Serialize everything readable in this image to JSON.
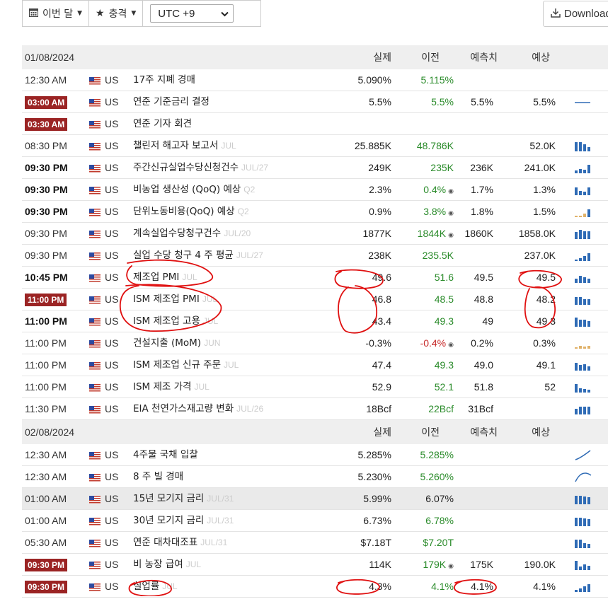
{
  "toolbar": {
    "period_label": "이번 달",
    "impact_label": "충격",
    "timezone_value": "UTC +9",
    "download_label": "Download"
  },
  "headers": {
    "actual": "실제",
    "previous": "이전",
    "forecast": "예측치",
    "consensus": "예상"
  },
  "sections": [
    {
      "date": "01/08/2024",
      "rows": [
        {
          "time": "12:30 AM",
          "style": "normal",
          "country": "US",
          "event": "17주 지폐 경매",
          "period": "",
          "actual": "5.090%",
          "previous": "5.115%",
          "prev_style": "green",
          "prev_dot": "",
          "forecast": "",
          "consensus": "",
          "chart": "none"
        },
        {
          "time": "03:00 AM",
          "style": "badge",
          "country": "US",
          "event": "연준 기준금리 결정",
          "period": "",
          "actual": "5.5%",
          "previous": "5.5%",
          "prev_style": "green",
          "prev_dot": "",
          "forecast": "5.5%",
          "consensus": "5.5%",
          "chart": "line"
        },
        {
          "time": "03:30 AM",
          "style": "badge",
          "country": "US",
          "event": "연준 기자 회견",
          "period": "",
          "actual": "",
          "previous": "",
          "prev_style": "green",
          "prev_dot": "",
          "forecast": "",
          "consensus": "",
          "chart": "none"
        },
        {
          "time": "08:30 PM",
          "style": "normal",
          "country": "US",
          "event": "챌린저 해고자 보고서",
          "period": "JUL",
          "actual": "25.885K",
          "previous": "48.786K",
          "prev_style": "green",
          "prev_dot": "",
          "forecast": "",
          "consensus": "52.0K",
          "chart": "bars-a"
        },
        {
          "time": "09:30 PM",
          "style": "bold",
          "country": "US",
          "event": "주간신규실업수당신청건수",
          "period": "JUL/27",
          "actual": "249K",
          "previous": "235K",
          "prev_style": "green",
          "prev_dot": "",
          "forecast": "236K",
          "consensus": "241.0K",
          "chart": "bars-b"
        },
        {
          "time": "09:30 PM",
          "style": "bold",
          "country": "US",
          "event": "비농업 생산성 (QoQ) 예상",
          "period": "Q2",
          "actual": "2.3%",
          "previous": "0.4%",
          "prev_style": "green",
          "prev_dot": "◉",
          "forecast": "1.7%",
          "consensus": "1.3%",
          "chart": "bars-c"
        },
        {
          "time": "09:30 PM",
          "style": "bold",
          "country": "US",
          "event": "단위노동비용(QoQ) 예상",
          "period": "Q2",
          "actual": "0.9%",
          "previous": "3.8%",
          "prev_style": "green",
          "prev_dot": "◉",
          "forecast": "1.8%",
          "consensus": "1.5%",
          "chart": "bars-mixed"
        },
        {
          "time": "09:30 PM",
          "style": "normal",
          "country": "US",
          "event": "계속실업수당청구건수",
          "period": "JUL/20",
          "actual": "1877K",
          "previous": "1844K",
          "prev_style": "green",
          "prev_dot": "◉",
          "forecast": "1860K",
          "consensus": "1858.0K",
          "chart": "bars-d"
        },
        {
          "time": "09:30 PM",
          "style": "normal",
          "country": "US",
          "event": "실업 수당 청구 4 주 평균",
          "period": "JUL/27",
          "actual": "238K",
          "previous": "235.5K",
          "prev_style": "green",
          "prev_dot": "",
          "forecast": "",
          "consensus": "237.0K",
          "chart": "bars-e"
        },
        {
          "time": "10:45 PM",
          "style": "bold",
          "country": "US",
          "event": "제조업 PMI",
          "period": "JUL",
          "actual": "49.6",
          "previous": "51.6",
          "prev_style": "green",
          "prev_dot": "",
          "forecast": "49.5",
          "consensus": "49.5",
          "chart": "bars-f"
        },
        {
          "time": "11:00 PM",
          "style": "badge",
          "country": "US",
          "event": "ISM 제조업 PMI",
          "period": "JUL",
          "actual": "46.8",
          "previous": "48.5",
          "prev_style": "green",
          "prev_dot": "",
          "forecast": "48.8",
          "consensus": "48.2",
          "chart": "bars-g"
        },
        {
          "time": "11:00 PM",
          "style": "bold",
          "country": "US",
          "event": "ISM 제조업 고용",
          "period": "JUL",
          "actual": "43.4",
          "previous": "49.3",
          "prev_style": "green",
          "prev_dot": "",
          "forecast": "49",
          "consensus": "49.3",
          "chart": "bars-h"
        },
        {
          "time": "11:00 PM",
          "style": "normal",
          "country": "US",
          "event": "건설지출 (MoM)",
          "period": "JUN",
          "actual": "-0.3%",
          "previous": "-0.4%",
          "prev_style": "red",
          "prev_dot": "◉",
          "forecast": "0.2%",
          "consensus": "0.3%",
          "chart": "bars-mixed2"
        },
        {
          "time": "11:00 PM",
          "style": "normal",
          "country": "US",
          "event": "ISM 제조업 신규 주문",
          "period": "JUL",
          "actual": "47.4",
          "previous": "49.3",
          "prev_style": "green",
          "prev_dot": "",
          "forecast": "49.0",
          "consensus": "49.1",
          "chart": "bars-i"
        },
        {
          "time": "11:00 PM",
          "style": "normal",
          "country": "US",
          "event": "ISM 제조 가격",
          "period": "JUL",
          "actual": "52.9",
          "previous": "52.1",
          "prev_style": "green",
          "prev_dot": "",
          "forecast": "51.8",
          "consensus": "52",
          "chart": "bars-j"
        },
        {
          "time": "11:30 PM",
          "style": "normal",
          "country": "US",
          "event": "EIA 천연가스재고량 변화",
          "period": "JUL/26",
          "actual": "18Bcf",
          "previous": "22Bcf",
          "prev_style": "green",
          "prev_dot": "",
          "forecast": "31Bcf",
          "consensus": "",
          "chart": "bars-k"
        }
      ]
    },
    {
      "date": "02/08/2024",
      "rows": [
        {
          "time": "12:30 AM",
          "style": "normal",
          "country": "US",
          "event": "4주물 국채 입찰",
          "period": "",
          "actual": "5.285%",
          "previous": "5.285%",
          "prev_style": "green",
          "prev_dot": "",
          "forecast": "",
          "consensus": "",
          "chart": "line-up"
        },
        {
          "time": "12:30 AM",
          "style": "normal",
          "country": "US",
          "event": "8 주 빌 경매",
          "period": "",
          "actual": "5.230%",
          "previous": "5.260%",
          "prev_style": "green",
          "prev_dot": "",
          "forecast": "",
          "consensus": "",
          "chart": "line-arc"
        },
        {
          "time": "01:00 AM",
          "style": "normal",
          "country": "US",
          "event": "15년 모기지 금리",
          "period": "JUL/31",
          "actual": "5.99%",
          "previous": "6.07%",
          "prev_style": "neutral",
          "prev_dot": "",
          "forecast": "",
          "consensus": "",
          "chart": "bars-l",
          "shade": true
        },
        {
          "time": "01:00 AM",
          "style": "normal",
          "country": "US",
          "event": "30년 모기지 금리",
          "period": "JUL/31",
          "actual": "6.73%",
          "previous": "6.78%",
          "prev_style": "green",
          "prev_dot": "",
          "forecast": "",
          "consensus": "",
          "chart": "bars-l"
        },
        {
          "time": "05:30 AM",
          "style": "normal",
          "country": "US",
          "event": "연준 대차대조표",
          "period": "JUL/31",
          "actual": "$7.18T",
          "previous": "$7.20T",
          "prev_style": "green",
          "prev_dot": "",
          "forecast": "",
          "consensus": "",
          "chart": "bars-m"
        },
        {
          "time": "09:30 PM",
          "style": "badge",
          "country": "US",
          "event": "비 농장 급여",
          "period": "JUL",
          "actual": "114K",
          "previous": "179K",
          "prev_style": "green",
          "prev_dot": "◉",
          "forecast": "175K",
          "consensus": "190.0K",
          "chart": "bars-n"
        },
        {
          "time": "09:30 PM",
          "style": "badge",
          "country": "US",
          "event": "실업률",
          "period": "JUL",
          "actual": "4.3%",
          "previous": "4.1%",
          "prev_style": "green",
          "prev_dot": "",
          "forecast": "4.1%",
          "consensus": "4.1%",
          "chart": "bars-o"
        }
      ]
    }
  ],
  "colors": {
    "badge": "#9b2424",
    "green": "#2a8b2a",
    "red": "#c62828",
    "bar": "#2f6bb5",
    "bar_forecast": "#e0b26a",
    "annotation": "#e01010"
  }
}
